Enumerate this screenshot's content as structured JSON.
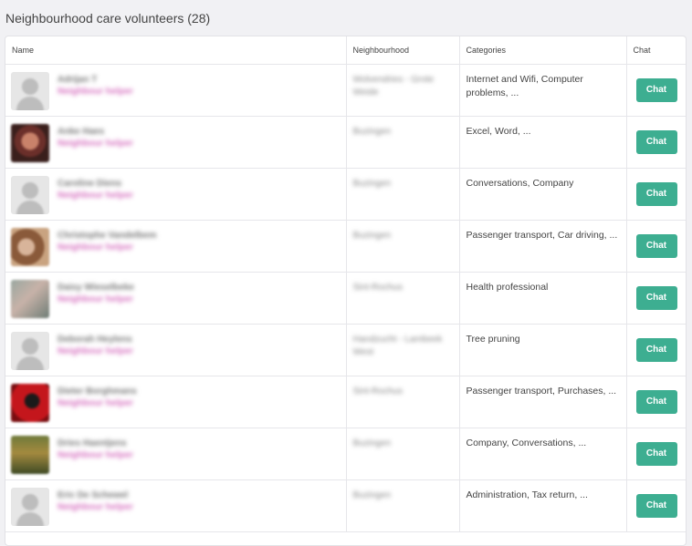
{
  "page": {
    "title": "Neighbourhood care volunteers (28)"
  },
  "table": {
    "headers": {
      "name": "Name",
      "neighbourhood": "Neighbourhood",
      "categories": "Categories",
      "chat": "Chat"
    },
    "chat_label": "Chat",
    "rows": [
      {
        "name": "Adrijan T",
        "role": "Neighbour helper",
        "neighbourhood": "Wolvendries - Grote Weide",
        "categories": "Internet and Wifi, Computer problems, ...",
        "avatar": "default"
      },
      {
        "name": "Anke Haes",
        "role": "Neighbour helper",
        "neighbourhood": "Buzingen",
        "categories": "Excel, Word, ...",
        "avatar": "photo-1"
      },
      {
        "name": "Caroline Diens",
        "role": "Neighbour helper",
        "neighbourhood": "Buzingen",
        "categories": "Conversations, Company",
        "avatar": "default"
      },
      {
        "name": "Christophe Vandelbem",
        "role": "Neighbour helper",
        "neighbourhood": "Buzingen",
        "categories": "Passenger transport, Car driving, ...",
        "avatar": "photo-2"
      },
      {
        "name": "Daisy Wieselbeke",
        "role": "Neighbour helper",
        "neighbourhood": "Sint-Rochus",
        "categories": "Health professional",
        "avatar": "photo-3"
      },
      {
        "name": "Deborah Heylens",
        "role": "Neighbour helper",
        "neighbourhood": "Handzucht - Lambeek West",
        "categories": "Tree pruning",
        "avatar": "default"
      },
      {
        "name": "Dieter Borghmans",
        "role": "Neighbour helper",
        "neighbourhood": "Sint-Rochus",
        "categories": "Passenger transport, Purchases, ...",
        "avatar": "photo-4"
      },
      {
        "name": "Dries Haentjens",
        "role": "Neighbour helper",
        "neighbourhood": "Buzingen",
        "categories": "Company, Conversations, ...",
        "avatar": "photo-5"
      },
      {
        "name": "Eric De Schewel",
        "role": "Neighbour helper",
        "neighbourhood": "Buzingen",
        "categories": "Administration, Tax return, ...",
        "avatar": "default"
      }
    ]
  },
  "colors": {
    "accent": "#3dae91",
    "role_text": "#d66fbf",
    "background": "#f1f1f4"
  },
  "icons": {
    "default_avatar": "user-silhouette-icon"
  }
}
